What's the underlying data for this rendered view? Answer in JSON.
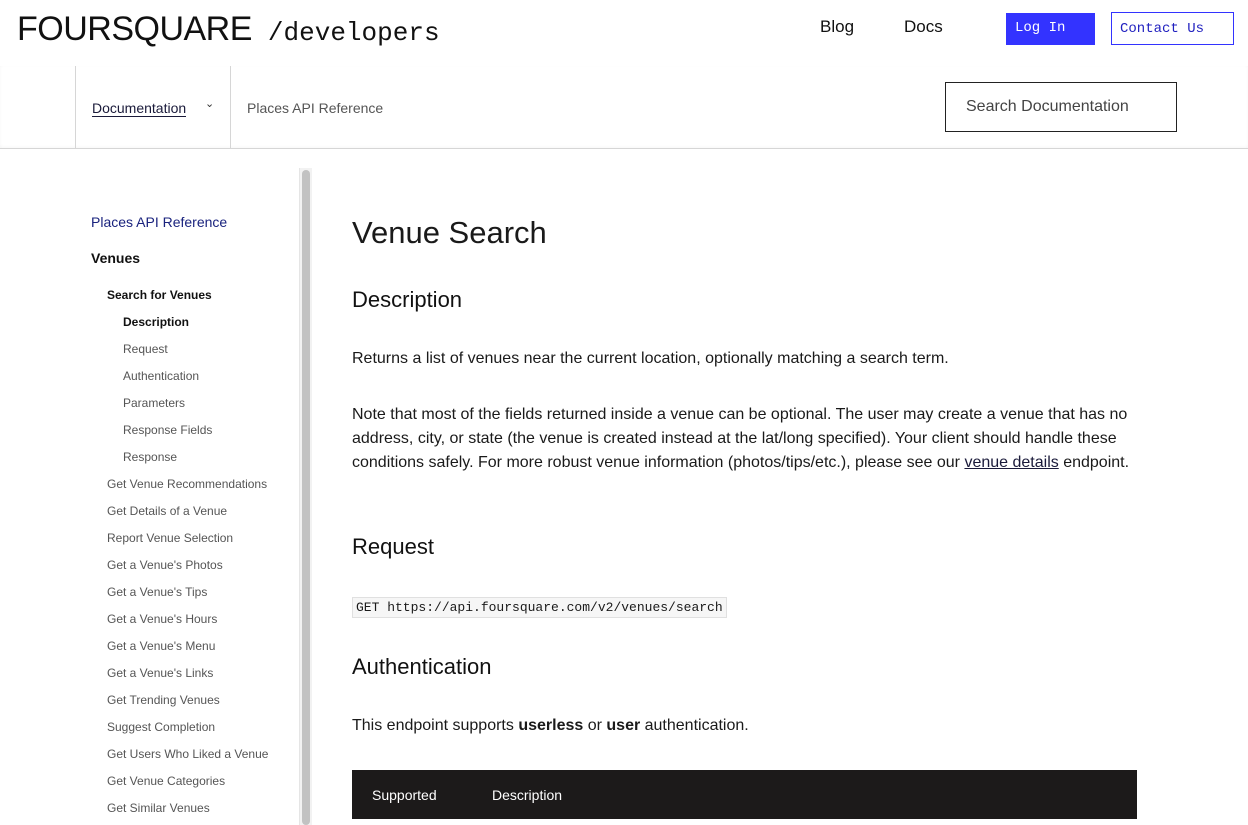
{
  "header": {
    "logo_word": "FOURSQUARE",
    "logo_dev": "/developers",
    "nav": {
      "blog": "Blog",
      "docs": "Docs"
    },
    "login_label": "Log In",
    "contact_label": "Contact Us",
    "accent_color": "#3333ff"
  },
  "subheader": {
    "doc_menu_label": "Documentation",
    "breadcrumb": "Places API Reference",
    "search_placeholder": "Search Documentation"
  },
  "sidebar": {
    "root": "Places API Reference",
    "section": "Venues",
    "active_group": "Search for Venues",
    "active_children": [
      "Description",
      "Request",
      "Authentication",
      "Parameters",
      "Response Fields",
      "Response"
    ],
    "items": [
      "Get Venue Recommendations",
      "Get Details of a Venue",
      "Report Venue Selection",
      "Get a Venue's Photos",
      "Get a Venue's Tips",
      "Get a Venue's Hours",
      "Get a Venue's Menu",
      "Get a Venue's Links",
      "Get Trending Venues",
      "Suggest Completion",
      "Get Users Who Liked a Venue",
      "Get Venue Categories",
      "Get Similar Venues"
    ]
  },
  "main": {
    "title": "Venue Search",
    "description_heading": "Description",
    "description_p1": "Returns a list of venues near the current location, optionally matching a search term.",
    "description_p2_before": "Note that most of the fields returned inside a venue can be optional. The user may create a venue that has no address, city, or state (the venue is created instead at the lat/long specified). Your client should handle these conditions safely. For more robust venue information (photos/tips/etc.), please see our ",
    "description_p2_link": "venue details",
    "description_p2_after": " endpoint.",
    "request_heading": "Request",
    "request_code": "GET https://api.foursquare.com/v2/venues/search",
    "auth_heading": "Authentication",
    "auth_before": "This endpoint supports ",
    "auth_bold1": "userless",
    "auth_mid": " or ",
    "auth_bold2": "user",
    "auth_after": " authentication.",
    "table_headers": [
      "Supported",
      "Description"
    ]
  }
}
